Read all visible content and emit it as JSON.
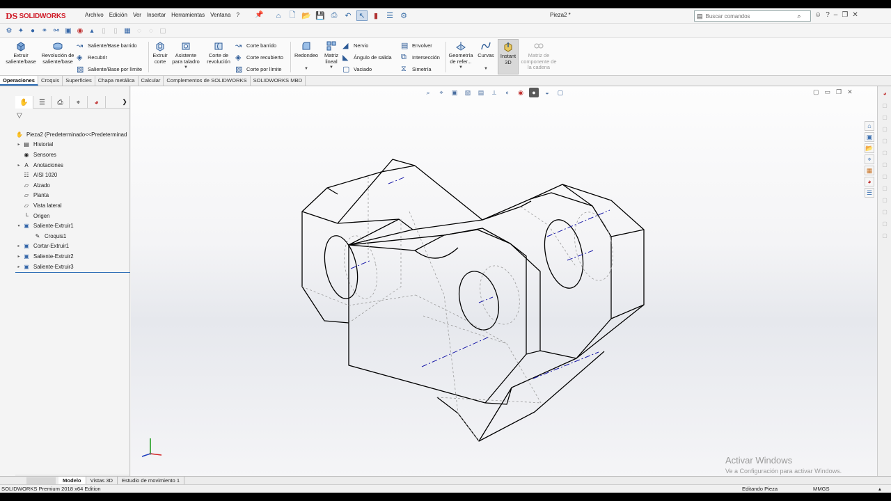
{
  "app": {
    "brand": "SOLIDWORKS",
    "brand_mark": "DS",
    "document_title": "Pieza2 *"
  },
  "menu": [
    "Archivo",
    "Edición",
    "Ver",
    "Insertar",
    "Herramientas",
    "Ventana",
    "?"
  ],
  "search": {
    "placeholder": "Buscar comandos"
  },
  "ribbon": {
    "extruir_saliente": "Extruir saliente/base",
    "revolucion_saliente": "Revolución de saliente/base",
    "saliente_barrido": "Saliente/Base barrido",
    "recubrir": "Recubrir",
    "saliente_limite": "Saliente/Base por límite",
    "extruir_corte": "Extruir corte",
    "asistente_taladro": "Asistente para taladro",
    "corte_revolucion": "Corte de revolución",
    "corte_barrido": "Corte barrido",
    "corte_recubierto": "Corte recubierto",
    "corte_limite": "Corte por límite",
    "redondeo": "Redondeo",
    "matriz_lineal": "Matriz lineal",
    "nervio": "Nervio",
    "angulo_salida": "Ángulo de salida",
    "vaciado": "Vaciado",
    "envolver": "Envolver",
    "interseccion": "Intersección",
    "simetria": "Simetría",
    "geometria_ref": "Geometría de refer...",
    "curvas": "Curvas",
    "instant3d": "Instant 3D",
    "matriz_cadena": "Matriz de componente de la cadena"
  },
  "tabs": [
    "Operaciones",
    "Croquis",
    "Superficies",
    "Chapa metálica",
    "Calcular",
    "Complementos de SOLIDWORKS",
    "SOLIDWORKS MBD"
  ],
  "active_tab": "Operaciones",
  "tree": {
    "root": "Pieza2  (Predeterminado<<Predeterminad",
    "items": [
      {
        "label": "Historial",
        "expandable": true
      },
      {
        "label": "Sensores",
        "expandable": false
      },
      {
        "label": "Anotaciones",
        "expandable": true
      },
      {
        "label": "AISI 1020",
        "expandable": false
      },
      {
        "label": "Alzado",
        "expandable": false
      },
      {
        "label": "Planta",
        "expandable": false
      },
      {
        "label": "Vista lateral",
        "expandable": false
      },
      {
        "label": "Origen",
        "expandable": false
      },
      {
        "label": "Saliente-Extruir1",
        "expandable": true,
        "expanded": true
      },
      {
        "label": "Croquis1",
        "expandable": false,
        "child": true
      },
      {
        "label": "Cortar-Extruir1",
        "expandable": true
      },
      {
        "label": "Saliente-Extruir2",
        "expandable": true
      },
      {
        "label": "Saliente-Extruir3",
        "expandable": true
      }
    ]
  },
  "bottom_tabs": [
    "Modelo",
    "Vistas 3D",
    "Estudio de movimiento 1"
  ],
  "active_bottom_tab": "Modelo",
  "status": {
    "product": "SOLIDWORKS Premium 2018 x64 Edition",
    "mode": "Editando Pieza",
    "units": "MMGS"
  },
  "watermark": {
    "line1": "Activar Windows",
    "line2": "Ve a Configuración para activar Windows."
  },
  "colors": {
    "brand": "#d01e2a",
    "accent": "#2b6cb5",
    "model_edge": "#000000",
    "hidden_edge": "#9a9a9a",
    "centerline": "#1a1aa8"
  }
}
